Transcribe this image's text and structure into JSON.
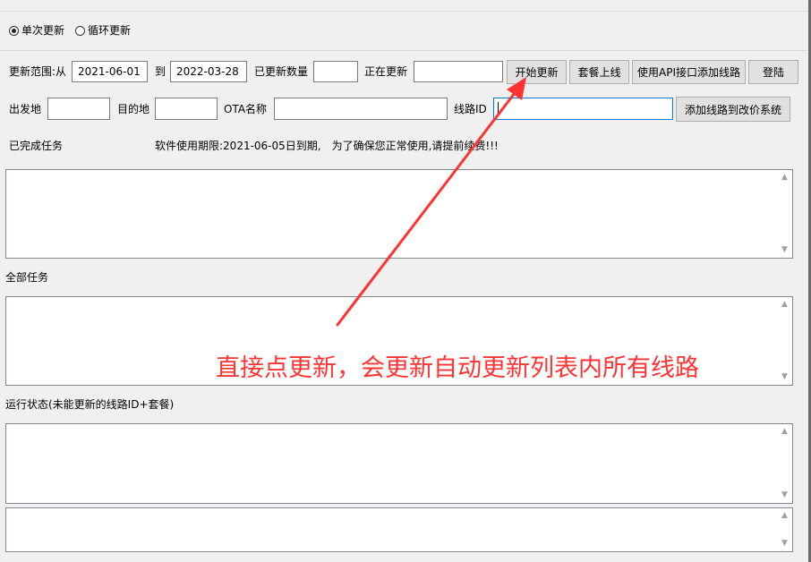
{
  "mode": {
    "options": [
      {
        "label": "单次更新",
        "selected": true
      },
      {
        "label": "循环更新",
        "selected": false
      }
    ]
  },
  "range": {
    "from_label": "更新范围:从",
    "from_value": "2021-06-01",
    "to_label": "到",
    "to_value": "2022-03-28",
    "updated_count_label": "已更新数量",
    "updated_count_value": "",
    "updating_label": "正在更新",
    "updating_value": ""
  },
  "buttons": {
    "start_update": "开始更新",
    "package_online": "套餐上线",
    "api_add_route": "使用API接口添加线路",
    "login": "登陆",
    "add_route_to_price": "添加线路到改价系统"
  },
  "route": {
    "departure_label": "出发地",
    "departure_value": "",
    "destination_label": "目的地",
    "destination_value": "",
    "ota_label": "OTA名称",
    "ota_value": "",
    "route_id_label": "线路ID",
    "route_id_value": ""
  },
  "status": {
    "completed_tasks_label": "已完成任务",
    "license_notice": "软件使用期限:2021-06-05日到期,　为了确保您正常使用,请提前续费!!!"
  },
  "sections": {
    "all_tasks_label": "全部任务",
    "run_status_label": "运行状态(未能更新的线路ID+套餐)"
  },
  "annotation": {
    "text": "直接点更新，会更新自动更新列表内所有线路",
    "color": "#ff3333"
  },
  "icons": {
    "scroll_up": "▲",
    "scroll_down": "▼"
  }
}
